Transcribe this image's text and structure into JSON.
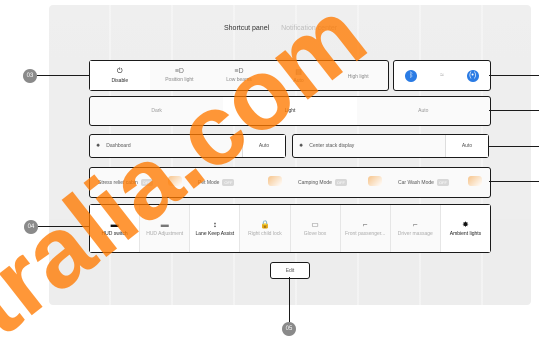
{
  "header": {
    "tab_active": "Shortcut panel",
    "tab_inactive": "Notification center"
  },
  "row1": {
    "items": [
      {
        "icon": "⏻",
        "label": "Disable"
      },
      {
        "icon": "≡D",
        "label": "Position light"
      },
      {
        "icon": "≡D",
        "label": "Low beams"
      },
      {
        "icon": "▤",
        "label": "Auto"
      },
      {
        "icon": "",
        "label": "High light"
      }
    ]
  },
  "row2": {
    "items": [
      "Dark",
      "Light",
      "Auto"
    ]
  },
  "row3": {
    "left_icon": "✹",
    "left_label": "Dashboard",
    "left_auto": "Auto",
    "right_icon": "✹",
    "right_label": "Center stack display",
    "right_auto": "Auto"
  },
  "row4": {
    "items": [
      {
        "label": "Stress relief cabin",
        "state": "OFF"
      },
      {
        "label": "Pet Mode",
        "state": "OFF"
      },
      {
        "label": "Camping Mode",
        "state": "OFF"
      },
      {
        "label": "Car Wash Mode",
        "state": "OFF"
      }
    ]
  },
  "row5": {
    "items": [
      {
        "icon": "▬",
        "label": "HUD switch"
      },
      {
        "icon": "▬",
        "label": "HUD Adjustment"
      },
      {
        "icon": "↕",
        "label": "Lane Keep Assist"
      },
      {
        "icon": "🔒",
        "label": "Right child lock"
      },
      {
        "icon": "▭",
        "label": "Glove box"
      },
      {
        "icon": "⌐",
        "label": "Front passenger..."
      },
      {
        "icon": "⌐",
        "label": "Driver massage"
      },
      {
        "icon": "✸",
        "label": "Ambient lights"
      }
    ]
  },
  "edit_label": "Edit",
  "callouts": {
    "c1": "03",
    "c2": "04",
    "c3": "05"
  },
  "right_icons": {
    "bluetooth": "ᛒ",
    "wifi": "≈",
    "hotspot": "(•)"
  },
  "watermark_text": "tralia.com"
}
